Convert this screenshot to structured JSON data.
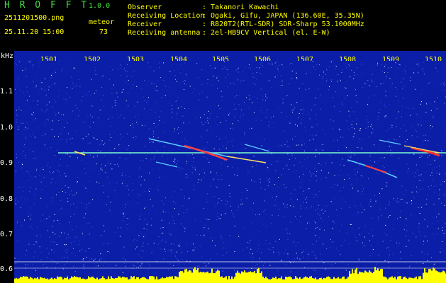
{
  "header": {
    "logo": "H R O F F T",
    "version": "1.0.0",
    "filename": "2511201500.png",
    "datetime": "25.11.20 15:00",
    "meteor_label": "meteor",
    "meteor_count": "73",
    "info": [
      {
        "label": "Observer",
        "value": ": Takanori Kawachi"
      },
      {
        "label": "Receiving Location",
        "value": ": Ogaki, Gifu, JAPAN (136.60E, 35.35N)"
      },
      {
        "label": "Receiver",
        "value": ": R820T2(RTL-SDR) SDR-Sharp 53.1000MHz"
      },
      {
        "label": "Receiving antenna",
        "value": ": 2el-HB9CV Vertical (el. E-W)"
      }
    ]
  },
  "axes": {
    "y_unit": "kHz",
    "y_ticks": [
      "1.1",
      "1.0",
      "0.9",
      "0.8",
      "0.7",
      "0.6"
    ],
    "x_ticks": [
      "1501",
      "1502",
      "1503",
      "1504",
      "1505",
      "1506",
      "1507",
      "1508",
      "1509",
      "1510"
    ]
  },
  "colors": {
    "background": "#0b1ea8",
    "carrier": "#7cffd0",
    "meteor_hot": "#ff3030",
    "level_bar": "#ffff00",
    "header_text": "#ffff00",
    "logo": "#3fe03f"
  }
}
